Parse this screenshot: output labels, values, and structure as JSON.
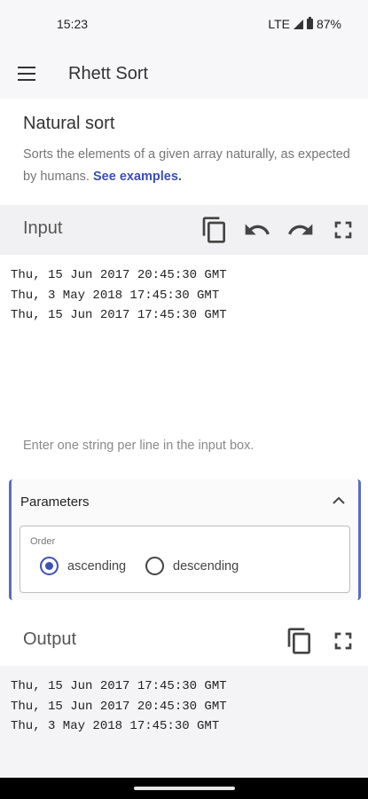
{
  "status_bar": {
    "time": "15:23",
    "network": "LTE",
    "battery": "87%"
  },
  "app_bar": {
    "title": "Rhett Sort"
  },
  "intro": {
    "title": "Natural sort",
    "description": "Sorts the elements of a given array naturally, as expected by humans.",
    "link": "See examples."
  },
  "input": {
    "label": "Input",
    "text": "Thu, 15 Jun 2017 20:45:30 GMT\nThu, 3 May 2018 17:45:30 GMT\nThu, 15 Jun 2017 17:45:30 GMT",
    "hint": "Enter one string per line in the input box."
  },
  "parameters": {
    "title": "Parameters",
    "order_label": "Order",
    "options": [
      {
        "label": "ascending",
        "selected": true
      },
      {
        "label": "descending",
        "selected": false
      }
    ]
  },
  "output": {
    "label": "Output",
    "text": "Thu, 15 Jun 2017 17:45:30 GMT\nThu, 15 Jun 2017 20:45:30 GMT\nThu, 3 May 2018 17:45:30 GMT"
  },
  "icons": [
    "menu-icon",
    "copy-icon",
    "undo-icon",
    "redo-icon",
    "fullscreen-icon",
    "chevron-up-icon"
  ],
  "colors": {
    "accent": "#3f51b5",
    "link": "#3a4fb1",
    "section_bg": "#f1f1f3"
  }
}
